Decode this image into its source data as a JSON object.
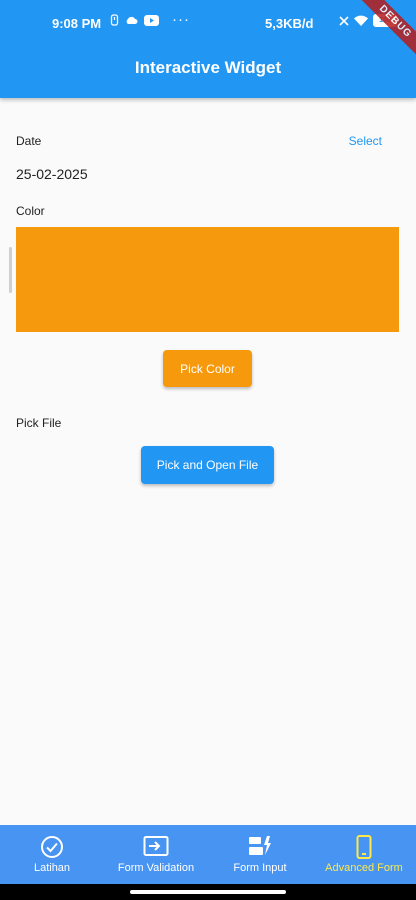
{
  "status_bar": {
    "time": "9:08 PM",
    "network_speed": "5,3KB/d",
    "battery": "100",
    "debug_label": "DEBUG"
  },
  "app_bar": {
    "title": "Interactive Widget"
  },
  "date_section": {
    "label": "Date",
    "select_label": "Select",
    "value": "25-02-2025"
  },
  "color_section": {
    "label": "Color",
    "selected_color": "#f7990c",
    "pick_button_label": "Pick Color"
  },
  "file_section": {
    "label": "Pick File",
    "button_label": "Pick and Open File"
  },
  "bottom_nav": {
    "items": [
      {
        "label": "Latihan",
        "icon": "check-circle-icon",
        "active": false
      },
      {
        "label": "Form Validation",
        "icon": "input-icon",
        "active": false
      },
      {
        "label": "Form Input",
        "icon": "dynamic-form-icon",
        "active": false
      },
      {
        "label": "Advanced Form",
        "icon": "phone-icon",
        "active": true
      }
    ]
  },
  "colors": {
    "primary": "#2196f3",
    "nav_background": "#4894f2",
    "nav_active": "#ffe94a"
  }
}
